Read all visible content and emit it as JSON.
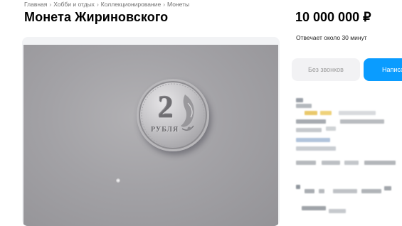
{
  "breadcrumbs": {
    "items": [
      {
        "label": "Главная"
      },
      {
        "label": "Хобби и отдых"
      },
      {
        "label": "Коллекционирование"
      },
      {
        "label": "Монеты"
      }
    ],
    "separator": "›"
  },
  "listing": {
    "title": "Монета Жириновского",
    "price": "10 000 000 ₽",
    "response_time": "Отвечает около 30 минут"
  },
  "photo": {
    "coin_denomination": "2",
    "coin_currency": "РУБЛЯ"
  },
  "actions": {
    "calls_label": "Без звонков",
    "write_label": "Написать"
  },
  "colors": {
    "accent": "#0a9cff",
    "secondary_button_bg": "#f2f2f4",
    "secondary_button_text": "#9a9a9a",
    "breadcrumb_text": "#6f6f6f"
  },
  "seller_block": {
    "redacted": true
  }
}
